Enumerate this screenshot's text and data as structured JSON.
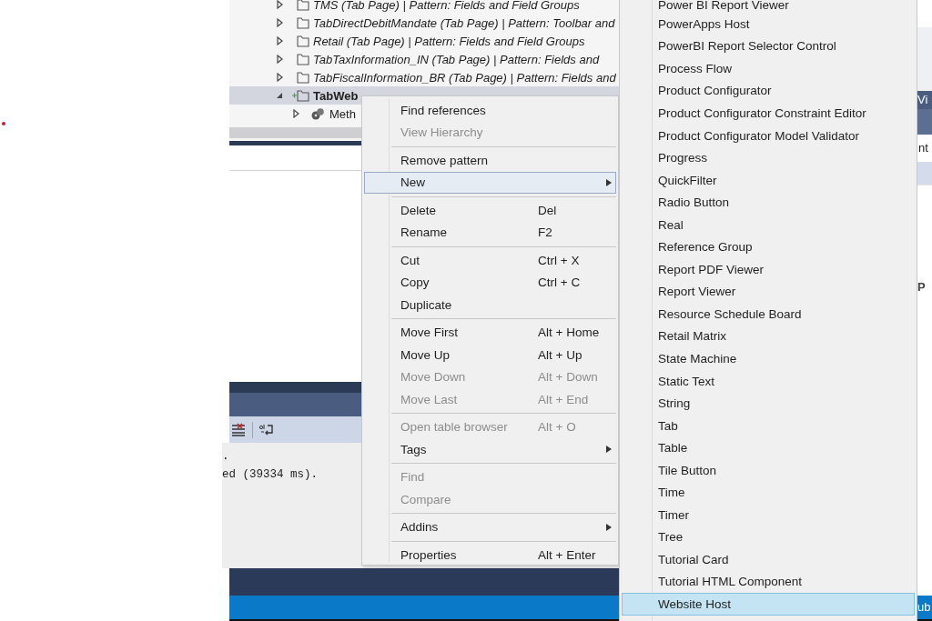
{
  "tree": [
    {
      "label": "TMS (Tab Page) | Pattern: Fields and Field Groups",
      "kind": "folder",
      "expanded": false,
      "selected": false,
      "added": false
    },
    {
      "label": "TabDirectDebitMandate (Tab Page) | Pattern: Toolbar and",
      "kind": "folder",
      "expanded": false,
      "selected": false,
      "added": false
    },
    {
      "label": "Retail (Tab Page) | Pattern: Fields and Field Groups",
      "kind": "folder",
      "expanded": false,
      "selected": false,
      "added": false
    },
    {
      "label": "TabTaxInformation_IN (Tab Page) | Pattern: Fields and",
      "kind": "folder",
      "expanded": false,
      "selected": false,
      "added": false
    },
    {
      "label": "TabFiscalInformation_BR (Tab Page) | Pattern: Fields and",
      "kind": "folder",
      "expanded": false,
      "selected": false,
      "added": false
    },
    {
      "label": "TabWeb",
      "kind": "folder",
      "expanded": true,
      "selected": true,
      "added": true,
      "children": [
        {
          "label": "Meth",
          "kind": "methods",
          "expanded": false,
          "selected": false
        }
      ]
    }
  ],
  "output": {
    "lines": [
      ".",
      "ed (39334 ms)."
    ]
  },
  "right_panel": {
    "header": "Vi",
    "label": "nt",
    "cell": "P"
  },
  "status_bar": {
    "text": "ub"
  },
  "context_menu": {
    "groups": [
      {
        "items": [
          {
            "label": "Find references",
            "disabled": false,
            "selected": false
          },
          {
            "label": "View Hierarchy",
            "disabled": true,
            "selected": false
          }
        ]
      },
      {
        "items": [
          {
            "label": "Remove pattern",
            "disabled": false,
            "selected": false
          },
          {
            "label": "New",
            "disabled": false,
            "selected": true,
            "submenu": true
          }
        ]
      },
      {
        "items": [
          {
            "label": "Delete",
            "shortcut": "Del",
            "disabled": false,
            "selected": false
          },
          {
            "label": "Rename",
            "shortcut": "F2",
            "disabled": false,
            "selected": false
          }
        ]
      },
      {
        "items": [
          {
            "label": "Cut",
            "shortcut": "Ctrl + X",
            "disabled": false,
            "selected": false
          },
          {
            "label": "Copy",
            "shortcut": "Ctrl + C",
            "disabled": false,
            "selected": false
          },
          {
            "label": "Duplicate",
            "disabled": false,
            "selected": false
          }
        ]
      },
      {
        "items": [
          {
            "label": "Move First",
            "shortcut": "Alt + Home",
            "disabled": false,
            "selected": false
          },
          {
            "label": "Move Up",
            "shortcut": "Alt + Up",
            "disabled": false,
            "selected": false
          },
          {
            "label": "Move Down",
            "shortcut": "Alt + Down",
            "disabled": true,
            "selected": false
          },
          {
            "label": "Move Last",
            "shortcut": "Alt + End",
            "disabled": true,
            "selected": false
          }
        ]
      },
      {
        "items": [
          {
            "label": "Open table browser",
            "shortcut": "Alt + O",
            "disabled": true,
            "selected": false
          },
          {
            "label": "Tags",
            "disabled": false,
            "selected": false,
            "submenu": true
          }
        ]
      },
      {
        "items": [
          {
            "label": "Find",
            "disabled": true,
            "selected": false
          },
          {
            "label": "Compare",
            "disabled": true,
            "selected": false
          }
        ]
      },
      {
        "items": [
          {
            "label": "Addins",
            "disabled": false,
            "selected": false,
            "submenu": true
          }
        ]
      },
      {
        "items": [
          {
            "label": "Properties",
            "shortcut": "Alt + Enter",
            "disabled": false,
            "selected": false
          }
        ]
      }
    ]
  },
  "submenu": {
    "items": [
      {
        "label": "Power BI Report Viewer",
        "selected": false
      },
      {
        "label": "PowerApps Host",
        "selected": false
      },
      {
        "label": "PowerBI Report Selector Control",
        "selected": false
      },
      {
        "label": "Process Flow",
        "selected": false
      },
      {
        "label": "Product Configurator",
        "selected": false
      },
      {
        "label": "Product Configurator Constraint Editor",
        "selected": false
      },
      {
        "label": "Product Configurator Model Validator",
        "selected": false
      },
      {
        "label": "Progress",
        "selected": false
      },
      {
        "label": "QuickFilter",
        "selected": false
      },
      {
        "label": "Radio Button",
        "selected": false
      },
      {
        "label": "Real",
        "selected": false
      },
      {
        "label": "Reference Group",
        "selected": false
      },
      {
        "label": "Report PDF Viewer",
        "selected": false
      },
      {
        "label": "Report Viewer",
        "selected": false
      },
      {
        "label": "Resource Schedule Board",
        "selected": false
      },
      {
        "label": "Retail Matrix",
        "selected": false
      },
      {
        "label": "State Machine",
        "selected": false
      },
      {
        "label": "Static Text",
        "selected": false
      },
      {
        "label": "String",
        "selected": false
      },
      {
        "label": "Tab",
        "selected": false
      },
      {
        "label": "Table",
        "selected": false
      },
      {
        "label": "Tile Button",
        "selected": false
      },
      {
        "label": "Time",
        "selected": false
      },
      {
        "label": "Timer",
        "selected": false
      },
      {
        "label": "Tree",
        "selected": false
      },
      {
        "label": "Tutorial Card",
        "selected": false
      },
      {
        "label": "Tutorial HTML Component",
        "selected": false
      },
      {
        "label": "Website Host",
        "selected": true
      }
    ]
  }
}
